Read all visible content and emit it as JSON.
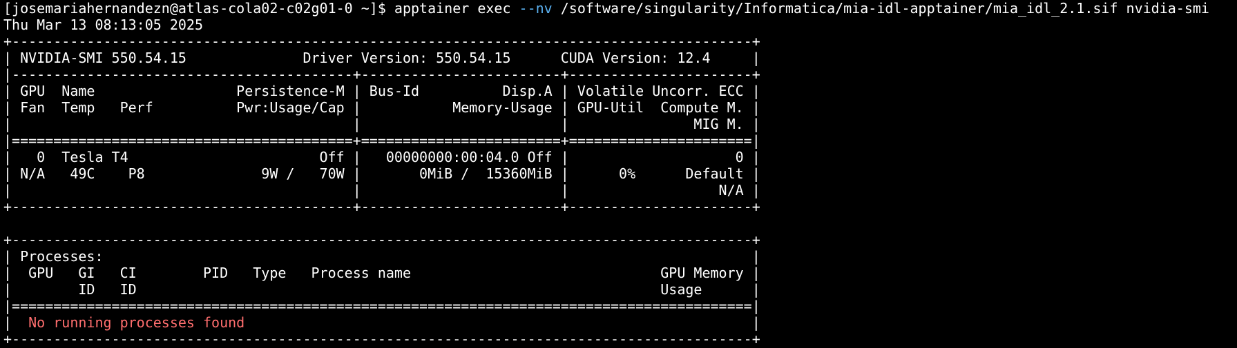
{
  "prompt": {
    "prefix": "[josemariahernandezn@atlas-cola02-c02g01-0 ~]$ apptainer exec ",
    "flag": "--nv",
    "rest": " /software/singularity/Informatica/mia-idl-apptainer/mia_idl_2.1.sif nvidia-smi"
  },
  "datetime": "Thu Mar 13 08:13:05 2025",
  "colors": {
    "background": "#000000",
    "foreground": "#ffffff",
    "flag": "#5ab0f0",
    "error": "#ff6e6e"
  },
  "smi_table": [
    "+-----------------------------------------------------------------------------------------+",
    "| NVIDIA-SMI 550.54.15              Driver Version: 550.54.15      CUDA Version: 12.4     |",
    "|-----------------------------------------+------------------------+----------------------+",
    "| GPU  Name                 Persistence-M | Bus-Id          Disp.A | Volatile Uncorr. ECC |",
    "| Fan  Temp   Perf          Pwr:Usage/Cap |           Memory-Usage | GPU-Util  Compute M. |",
    "|                                         |                        |               MIG M. |",
    "|=========================================+========================+======================|",
    "|   0  Tesla T4                       Off |   00000000:00:04.0 Off |                    0 |",
    "| N/A   49C    P8              9W /   70W |       0MiB /  15360MiB |      0%      Default |",
    "|                                         |                        |                  N/A |",
    "+-----------------------------------------+------------------------+----------------------+"
  ],
  "blank": "",
  "processes_table": [
    "+-----------------------------------------------------------------------------------------+",
    "| Processes:                                                                              |",
    "|  GPU   GI   CI        PID   Type   Process name                              GPU Memory |",
    "|        ID   ID                                                               Usage      |",
    "|=========================================================================================|"
  ],
  "no_processes": {
    "prefix": "|  ",
    "message": "No running processes found",
    "suffix": "                                                             |"
  },
  "processes_footer": "+-----------------------------------------------------------------------------------------+"
}
